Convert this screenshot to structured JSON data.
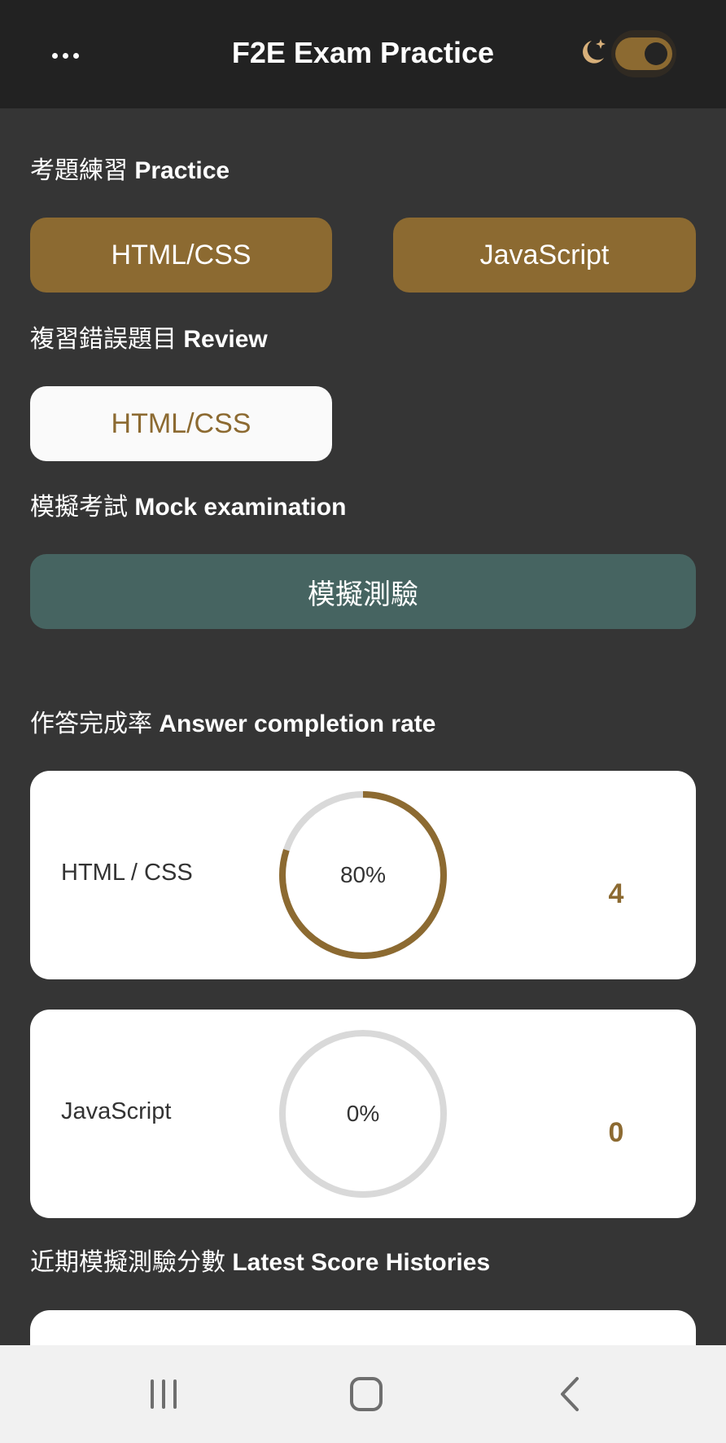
{
  "header": {
    "menu_icon": "more-horizontal-icon",
    "title": "F2E Exam Practice",
    "theme_icon": "moon-stars-icon",
    "dark_mode": true
  },
  "practice": {
    "heading_zh": "考題練習",
    "heading_en": "Practice",
    "buttons": [
      "HTML/CSS",
      "JavaScript"
    ]
  },
  "review": {
    "heading_zh": "複習錯誤題目",
    "heading_en": "Review",
    "button": "HTML/CSS"
  },
  "mock": {
    "heading_zh": "模擬考試",
    "heading_en": "Mock examination",
    "button": "模擬測驗"
  },
  "completion": {
    "heading_zh": "作答完成率",
    "heading_en": "Answer completion rate",
    "items": [
      {
        "label": "HTML / CSS",
        "percent": 80,
        "percent_text": "80%",
        "count": "4"
      },
      {
        "label": "JavaScript",
        "percent": 0,
        "percent_text": "0%",
        "count": "0"
      }
    ]
  },
  "history": {
    "heading_zh": "近期模擬測驗分數",
    "heading_en": "Latest Score Histories"
  },
  "nav": {
    "recent_icon": "recent-apps-icon",
    "home_icon": "home-icon",
    "back_icon": "back-icon"
  },
  "colors": {
    "accent": "#8c6a31",
    "teal": "#466461",
    "background": "#353535",
    "header": "#222222",
    "ring_track": "#d9d9d9"
  }
}
